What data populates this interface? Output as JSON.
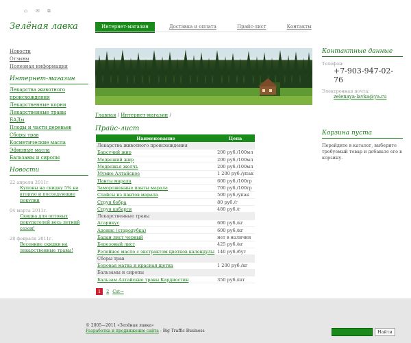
{
  "top_icons": [
    "home-icon",
    "mail-icon",
    "sitemap-icon"
  ],
  "logo": "Зелёная лавка",
  "main_nav": [
    {
      "label": "Интернет-магазин",
      "active": true
    },
    {
      "label": "Доставка и оплата",
      "active": false
    },
    {
      "label": "Прайс-лист",
      "active": false
    },
    {
      "label": "Контакты",
      "active": false
    }
  ],
  "left_links": [
    "Новости",
    "Отзывы",
    "Полезная информация"
  ],
  "shop_section": {
    "title": "Интернет-магазин",
    "items": [
      "Лекарства животного происхождения",
      "Лекарственные корни",
      "Лекарственные травы",
      "БАДы",
      "Плоды и части деревьев",
      "Сборы трав",
      "Косметические масла",
      "Эфирные масла",
      "Бальзамы и сиропы"
    ]
  },
  "news": {
    "title": "Новости",
    "items": [
      {
        "date": "22 апреля 2011г.",
        "text": "Купоны на скидку 5% на вторую и последующие покупки"
      },
      {
        "date": "04 марта 2011г.",
        "text": "Скидка для оптовых покупателей весь летний сезон!"
      },
      {
        "date": "28 февраля 2011г.",
        "text": "Весенние скидки на лекарственные травы!"
      }
    ]
  },
  "breadcrumbs": [
    "Главная",
    "Интернет-магазин"
  ],
  "page_title": "Прайс-лист",
  "price_table": {
    "headers": [
      "Наименование",
      "Цена"
    ],
    "rows": [
      {
        "cat": "Лекарства животного происхождения"
      },
      {
        "name": "Барсучий жир",
        "price": "200 руб./100мл"
      },
      {
        "name": "Медвежий жир",
        "price": "200 руб./100мл"
      },
      {
        "name": "Медвежья желчь",
        "price": "200 руб./100мл"
      },
      {
        "name": "Мумие Алтайское",
        "price": "1 200 руб./упак"
      },
      {
        "name": "Панты марала",
        "price": "600 руб./100гр"
      },
      {
        "name": "Замороженные панты марала",
        "price": "700 руб./100гр"
      },
      {
        "name": "Слайсы из пантов марала",
        "price": "500 руб./упак"
      },
      {
        "name": "Струя бобра",
        "price": "80 руб./г"
      },
      {
        "name": "Струя кабарги",
        "price": "480 руб./г"
      },
      {
        "cat": "Лекарственные травы"
      },
      {
        "name": "Агарикус",
        "price": "600 руб./кг"
      },
      {
        "name": "Адонис (стародубка)",
        "price": "600 руб./кг"
      },
      {
        "name": "Бадан лист черный",
        "price": "нет в наличии"
      },
      {
        "name": "Березовый лист",
        "price": "425 руб./кг"
      },
      {
        "name": "Релейное масло с экстрактом цветков календулы",
        "price": "140 руб./бут"
      },
      {
        "cat": "Сборы трав"
      },
      {
        "name": "Боровая матка и красная щетка",
        "price": "1 200 руб./кг"
      },
      {
        "cat": "Бальзамы и сиропы"
      },
      {
        "name": "Бальзам Алтайские травы Кардиостин",
        "price": "350 руб./шт"
      }
    ]
  },
  "pager": {
    "current": "1",
    "pages": [
      "2"
    ],
    "next": "Cst→"
  },
  "contacts": {
    "title": "Контактные данные",
    "phone_label": "Телефон:",
    "phone": "+7-903-947-02-76",
    "email_label": "Электронная почта:",
    "email": "zelenaya-lavka@ya.ru"
  },
  "cart": {
    "title": "Корзина пуста",
    "text": "Перейдите в каталог, выберите требуемый товар и добавьте его в корзину."
  },
  "footer": {
    "copyright": "© 2005—2011 «Зелёная лавка»",
    "dev_link": "Разработка и продвижение сайта",
    "dev_suffix": " - Big Traffic Business"
  },
  "search": {
    "button": "Найти"
  }
}
